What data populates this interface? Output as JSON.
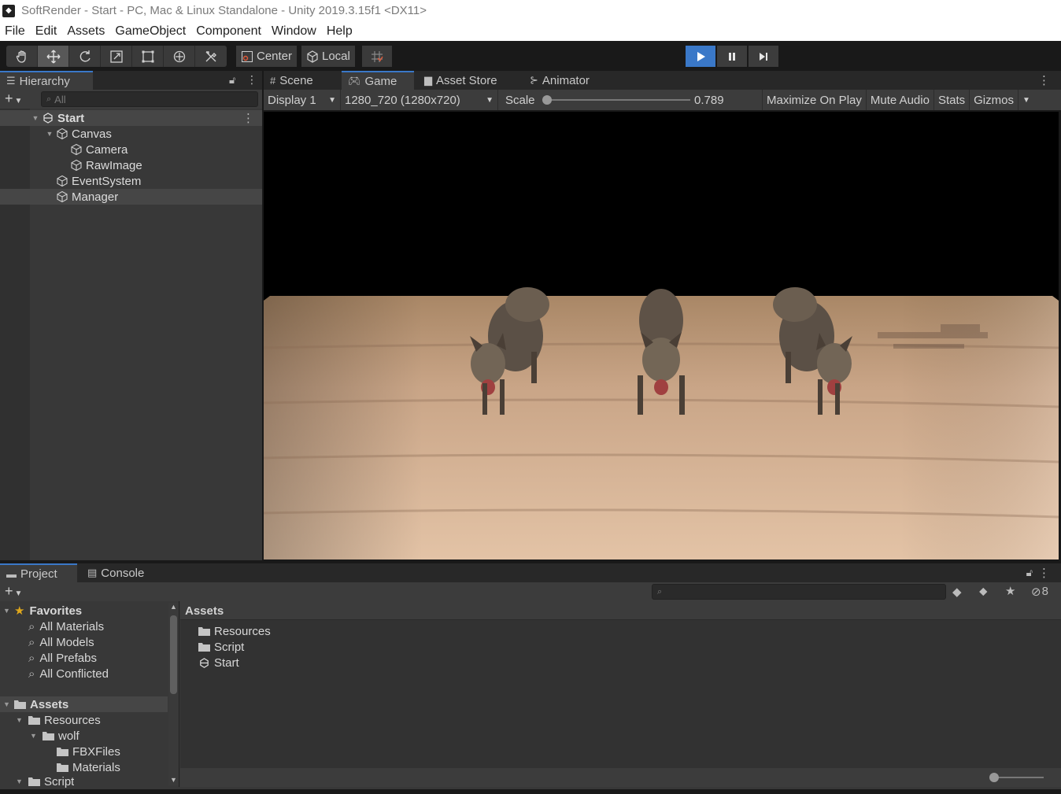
{
  "window": {
    "title": "SoftRender - Start - PC, Mac & Linux Standalone - Unity 2019.3.15f1 <DX11>"
  },
  "menu": [
    "File",
    "Edit",
    "Assets",
    "GameObject",
    "Component",
    "Window",
    "Help"
  ],
  "toolbar": {
    "pivot_label": "Center",
    "space_label": "Local"
  },
  "hierarchy": {
    "tab_label": "Hierarchy",
    "search_placeholder": "All",
    "scene": "Start",
    "items": [
      "Canvas",
      "Camera",
      "RawImage",
      "EventSystem",
      "Manager"
    ]
  },
  "center_tabs": [
    "Scene",
    "Game",
    "Asset Store",
    "Animator"
  ],
  "game_bar": {
    "display": "Display 1",
    "resolution": "1280_720 (1280x720)",
    "scale_label": "Scale",
    "scale_value": "0.789",
    "maximize": "Maximize On Play",
    "mute": "Mute Audio",
    "stats": "Stats",
    "gizmos": "Gizmos"
  },
  "bottom_tabs": [
    "Project",
    "Console"
  ],
  "project": {
    "hidden_count": "8",
    "favorites_label": "Favorites",
    "favorites": [
      "All Materials",
      "All Models",
      "All Prefabs",
      "All Conflicted"
    ],
    "tree_root": "Assets",
    "tree": [
      "Resources",
      "wolf",
      "FBXFiles",
      "Materials",
      "Script"
    ],
    "breadcrumb": "Assets",
    "contents": [
      "Resources",
      "Script",
      "Start"
    ]
  },
  "colors": {
    "accent": "#3a78c8",
    "panel": "#383838",
    "tabstrip": "#282828",
    "floor": "#d9b494"
  }
}
